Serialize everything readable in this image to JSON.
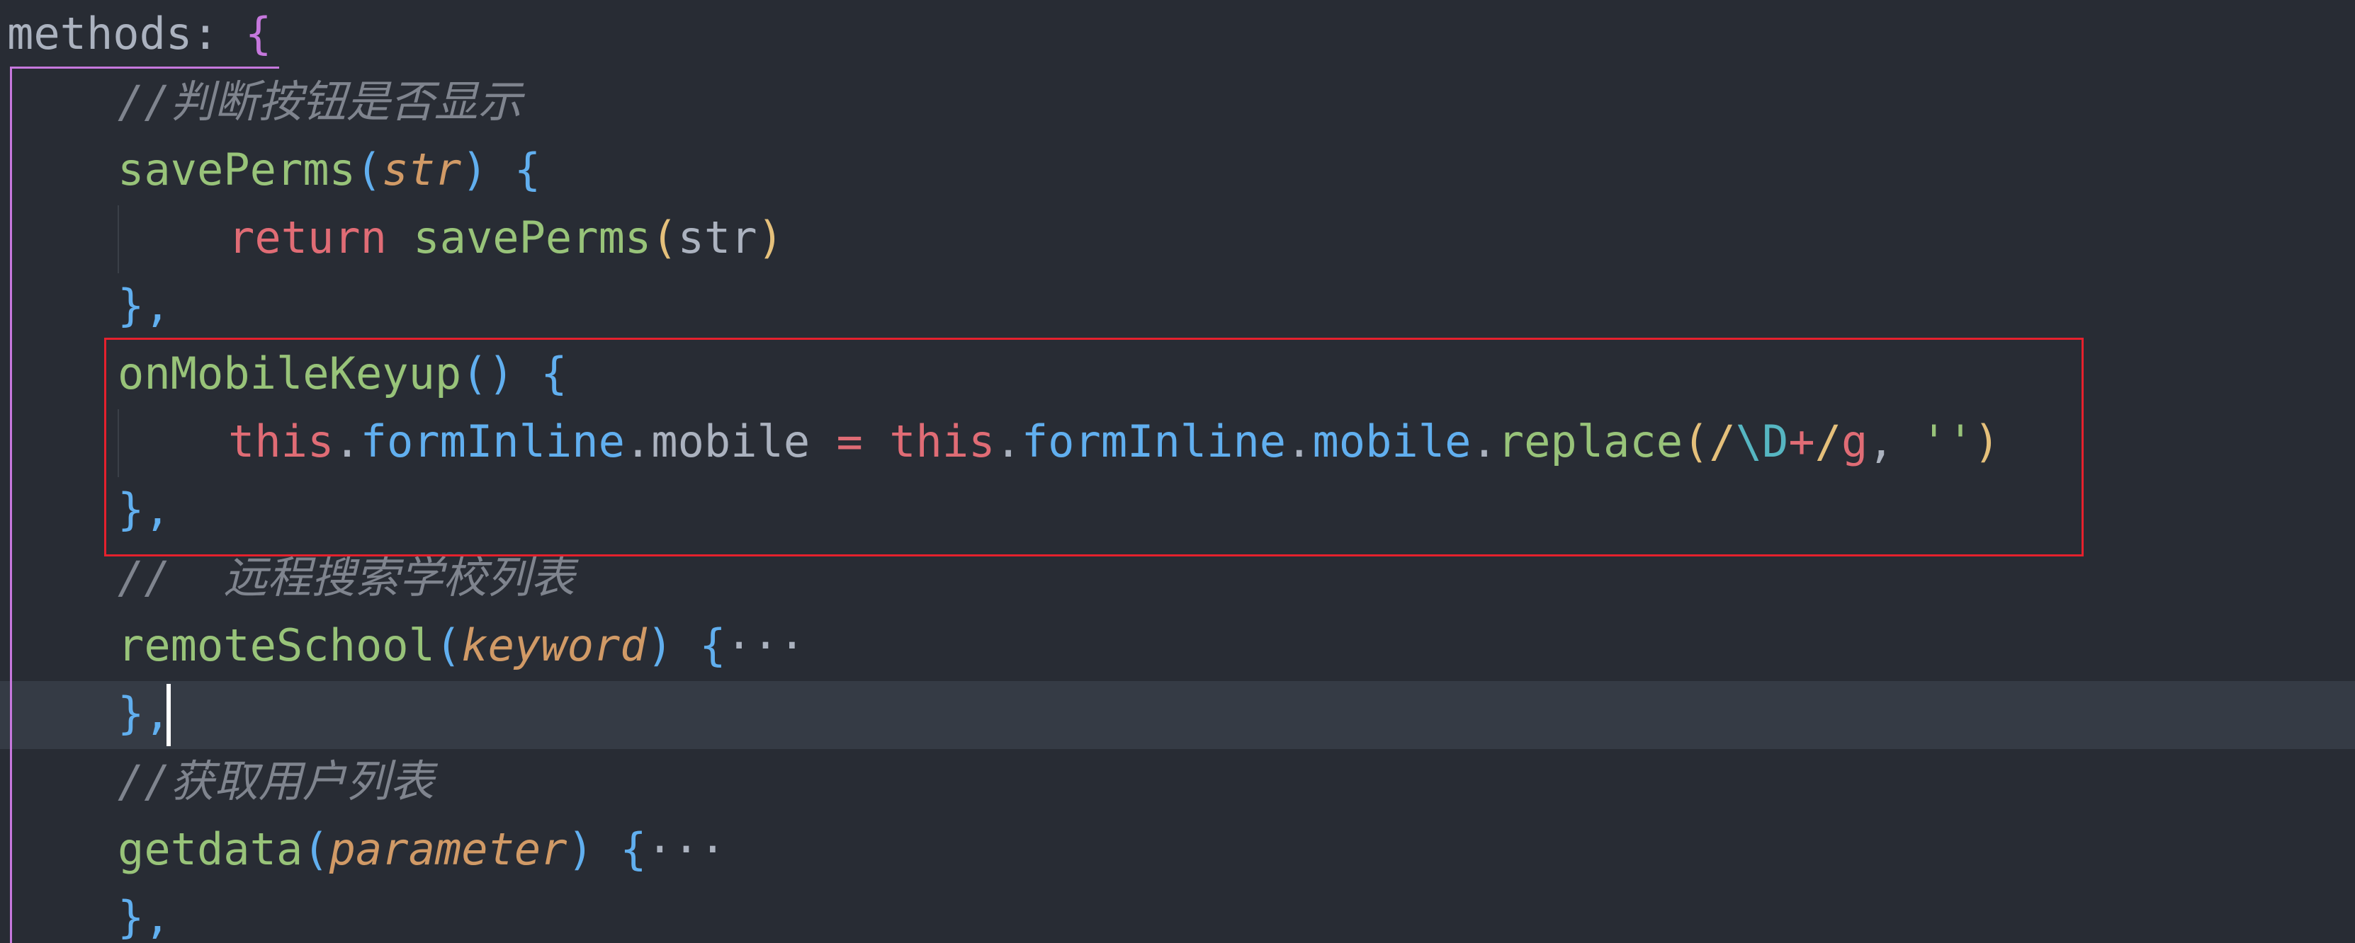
{
  "code": {
    "line1": {
      "methods": "methods",
      "colon": ": ",
      "brace": "{"
    },
    "line2": {
      "comment": "//判断按钮是否显示"
    },
    "line3": {
      "name": "savePerms",
      "open": "(",
      "param": "str",
      "close": ")",
      "brace": " {"
    },
    "line4": {
      "kw": "return",
      "name": " savePerms",
      "open": "(",
      "arg": "str",
      "close": ")"
    },
    "line5": {
      "text": "},"
    },
    "line6": {
      "name": "onMobileKeyup",
      "parens": "()",
      "brace": " {"
    },
    "line7": {
      "this1": "this",
      "dot1": ".",
      "form1": "formInline",
      "dot2": ".",
      "mobile1": "mobile",
      "eq": " = ",
      "this2": "this",
      "dot3": ".",
      "form2": "formInline",
      "dot4": ".",
      "mobile2": "mobile",
      "dot5": ".",
      "replace": "replace",
      "open": "(",
      "rx_slash1": "/",
      "rx_esc": "\\D",
      "rx_plus": "+",
      "rx_slash2": "/",
      "rx_flag": "g",
      "comma": ", ",
      "str": "''",
      "close": ")"
    },
    "line8": {
      "text": "},"
    },
    "line9": {
      "comment": "//  远程搜索学校列表"
    },
    "line10": {
      "name": "remoteSchool",
      "open": "(",
      "param": "keyword",
      "close": ")",
      "brace": " {",
      "fold": "···"
    },
    "line11": {
      "text": "},"
    },
    "line12": {
      "comment": "//获取用户列表"
    },
    "line13": {
      "name": "getdata",
      "open": "(",
      "param": "parameter",
      "close": ")",
      "brace": " {",
      "fold": "···"
    },
    "line14": {
      "text": "},"
    }
  },
  "colors": {
    "background": "#282c34",
    "current_line": "#353b45",
    "highlight_box": "#e5212d"
  }
}
